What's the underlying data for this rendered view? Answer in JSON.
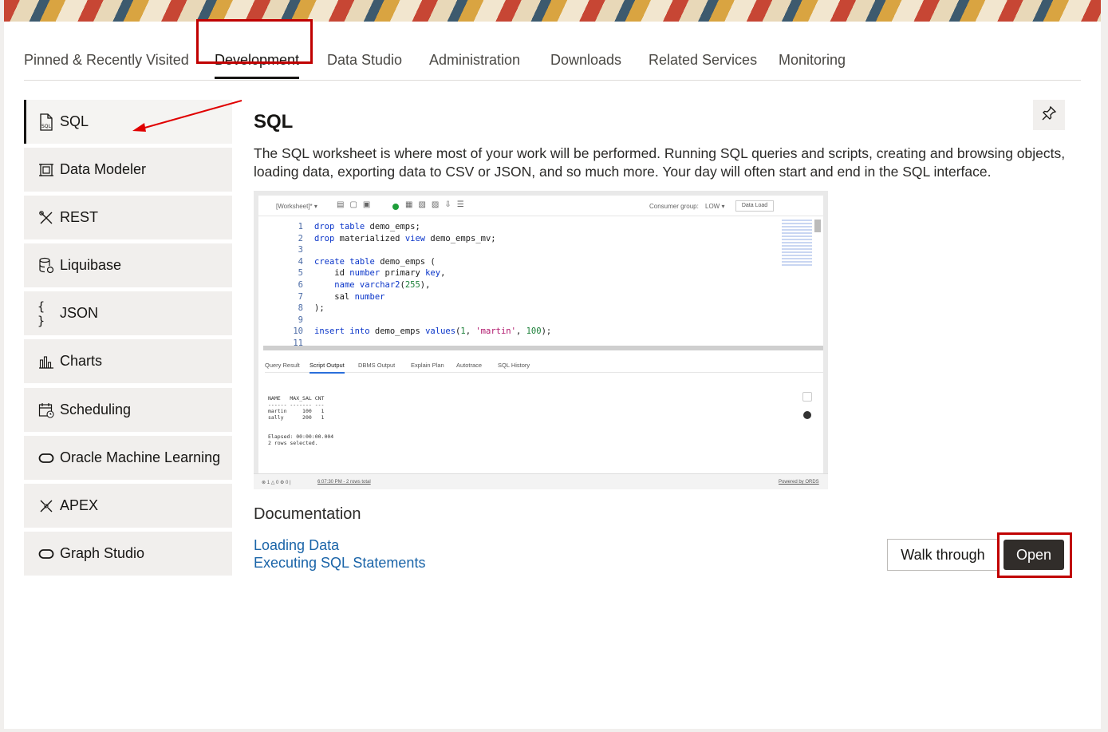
{
  "tabs": [
    {
      "label": "Pinned & Recently Visited"
    },
    {
      "label": "Development",
      "active": true
    },
    {
      "label": "Data Studio"
    },
    {
      "label": "Administration"
    },
    {
      "label": "Downloads"
    },
    {
      "label": "Related Services"
    },
    {
      "label": "Monitoring"
    }
  ],
  "sidebar": {
    "items": [
      {
        "label": "SQL",
        "icon": "sql-file-icon",
        "active": true
      },
      {
        "label": "Data Modeler",
        "icon": "data-modeler-icon"
      },
      {
        "label": "REST",
        "icon": "rest-tools-icon"
      },
      {
        "label": "Liquibase",
        "icon": "liquibase-database-icon"
      },
      {
        "label": "JSON",
        "icon": "json-braces-icon"
      },
      {
        "label": "Charts",
        "icon": "bar-chart-icon"
      },
      {
        "label": "Scheduling",
        "icon": "calendar-clock-icon"
      },
      {
        "label": "Oracle Machine Learning",
        "icon": "oracle-pill-icon"
      },
      {
        "label": "APEX",
        "icon": "apex-tools-icon"
      },
      {
        "label": "Graph Studio",
        "icon": "oracle-pill-icon"
      }
    ]
  },
  "main": {
    "title": "SQL",
    "description": "The SQL worksheet is where most of your work will be performed. Running SQL queries and scripts, creating and browsing objects, loading data, exporting data to CSV or JSON, and so much more. Your day will often start and end in the SQL interface.",
    "pin_icon": "pin-icon",
    "documentation": {
      "heading": "Documentation",
      "links": [
        {
          "label": "Loading Data"
        },
        {
          "label": "Executing SQL Statements"
        }
      ]
    },
    "walkthrough_label": "Walk through",
    "open_label": "Open"
  },
  "worksheet_preview": {
    "toolbar": {
      "worksheet_label": "[Worksheet]* ▾",
      "consumer_group_label": "Consumer group:",
      "consumer_group_value": "LOW ▾",
      "data_load_label": "Data Load"
    },
    "code_lines": [
      {
        "n": "1",
        "html": "<span class='kw'>drop</span> <span class='kw'>table</span> demo_emps;"
      },
      {
        "n": "2",
        "html": "<span class='kw'>drop</span> materialized <span class='kw'>view</span> demo_emps_mv;"
      },
      {
        "n": "3",
        "html": ""
      },
      {
        "n": "4",
        "html": "<span class='kw'>create</span> <span class='kw'>table</span> demo_emps ("
      },
      {
        "n": "5",
        "html": "    id <span class='kw'>number</span> primary <span class='kw'>key</span>,"
      },
      {
        "n": "6",
        "html": "    <span class='kw'>name</span> <span class='kw'>varchar2</span>(<span class='num'>255</span>),"
      },
      {
        "n": "7",
        "html": "    sal <span class='kw'>number</span>"
      },
      {
        "n": "8",
        "html": ");"
      },
      {
        "n": "9",
        "html": ""
      },
      {
        "n": "10",
        "html": "<span class='kw'>insert</span> <span class='kw'>into</span> demo_emps <span class='kw'>values</span>(<span class='num'>1</span>, <span class='str'>'martin'</span>, <span class='num'>100</span>);"
      },
      {
        "n": "11",
        "html": ""
      }
    ],
    "output_tabs": [
      "Query Result",
      "Script Output",
      "DBMS Output",
      "Explain Plan",
      "Autotrace",
      "SQL History"
    ],
    "active_output_tab": "Script Output",
    "output_text": "NAME   MAX_SAL CNT\n------ ------- ---\nmartin     100   1\nsally      200   1\n\n\nElapsed: 00:00:00.004\n2 rows selected.",
    "status_left": "⊗ 1 △ 0 ⚙ 0 |",
    "status_time": "6:07:30 PM - 2 rows total",
    "status_right": "Powered by ORDS"
  }
}
